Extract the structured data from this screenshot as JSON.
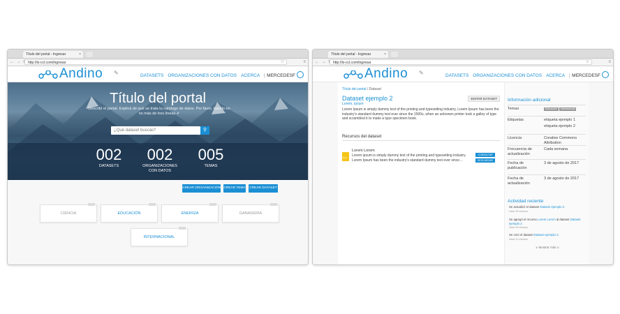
{
  "browser": {
    "tab_title": "Título del portal - Ingresar",
    "tab_close": "×",
    "url": "http://ts-ccl.com/ingresar",
    "nav_glyphs": "← → C",
    "star": "☆",
    "menu": "≡"
  },
  "site": {
    "brand": "Andino",
    "nav": {
      "datasets": "DATASETS",
      "organizaciones": "ORGANIZACIONES CON DATOS",
      "acerca": "ACERCA",
      "user": "MERCEDESF",
      "user_short": "MERCEDESF"
    }
  },
  "home": {
    "title": "Título del portal",
    "description": "Describí el portal. Explicá de qué se trata tu catálogo de datos. Por favor, hacelo en no más de tres líneas ✔",
    "search_placeholder": "¿Qué dataset buscás?",
    "stats": [
      {
        "num": "002",
        "label": "DATASETS"
      },
      {
        "num": "002",
        "label": "ORGANIZACIONES CON DATOS"
      },
      {
        "num": "005",
        "label": "TEMAS"
      }
    ],
    "buttons": {
      "crear_org": "CREAR ORGANIZACIÓN",
      "crear_tema": "CREAR TEMA",
      "crear_dataset": "CREAR DATASET"
    },
    "topics": [
      "CIENCIA",
      "EDUCACIÓN",
      "ENERGÍA",
      "GANADERÍA",
      "INTERNACIONAL"
    ]
  },
  "dataset": {
    "breadcrumb_link": "Título del portal",
    "breadcrumb_current": "/ Dataset",
    "title": "Dataset ejemplo 2",
    "org": "Lorem, Ipsum",
    "edit": "EDITAR DATASET",
    "description": "Lorem Ipsum is simply dummy text of the printing and typesetting industry. Lorem Ipsum has been the industry's standard dummy text ever since the 1500s, when an unknown printer took a galley of type and scrambled it to make a type specimen book.",
    "resources_heading": "Recursos del dataset",
    "resource": {
      "title": "Lorem Lorem",
      "description": "Lorem ipsum is simply dummy text of the printing and typesetting industry. Lorem Ipsum has been the industry's standard dummy text ever since…",
      "consultar": "CONSULTAR",
      "descargar": "DESCARGAR"
    },
    "info": {
      "heading": "Información adicional",
      "rows": [
        {
          "k": "Temas",
          "v": ""
        },
        {
          "k": "Etiquetas",
          "v": "etiqueta ejemplo 1"
        },
        {
          "k": "",
          "v": "etiqueta ejemplo 2"
        },
        {
          "k": "Licencia",
          "v": "Creative Commons Attribution"
        },
        {
          "k": "Frecuencia de actualización",
          "v": "Cada semana"
        },
        {
          "k": "Fecha de publicación",
          "v": "3 de agosto de 2017"
        },
        {
          "k": "Fecha de actualización",
          "v": "3 de agosto de 2017"
        }
      ],
      "tags": [
        "Educación",
        "Internacional"
      ]
    },
    "activity": {
      "heading": "Actividad reciente",
      "items": [
        {
          "pre": "Se actualizó el dataset ",
          "link": "Dataset ejemplo 2",
          "post": ".",
          "time": "Hace 39 minutos"
        },
        {
          "pre": "Se agregó el recurso ",
          "link": "Lorem Lorem",
          "post": " al dataset ",
          "link2": "Dataset ejemplo 2",
          "time": "Hace 39 minutos"
        },
        {
          "pre": "Se creó el dataset ",
          "link": "Dataset ejemplo 2",
          "post": ".",
          "time": "Hace 41 minutos"
        }
      ],
      "more": "∨ Mostrar más ∨"
    }
  }
}
